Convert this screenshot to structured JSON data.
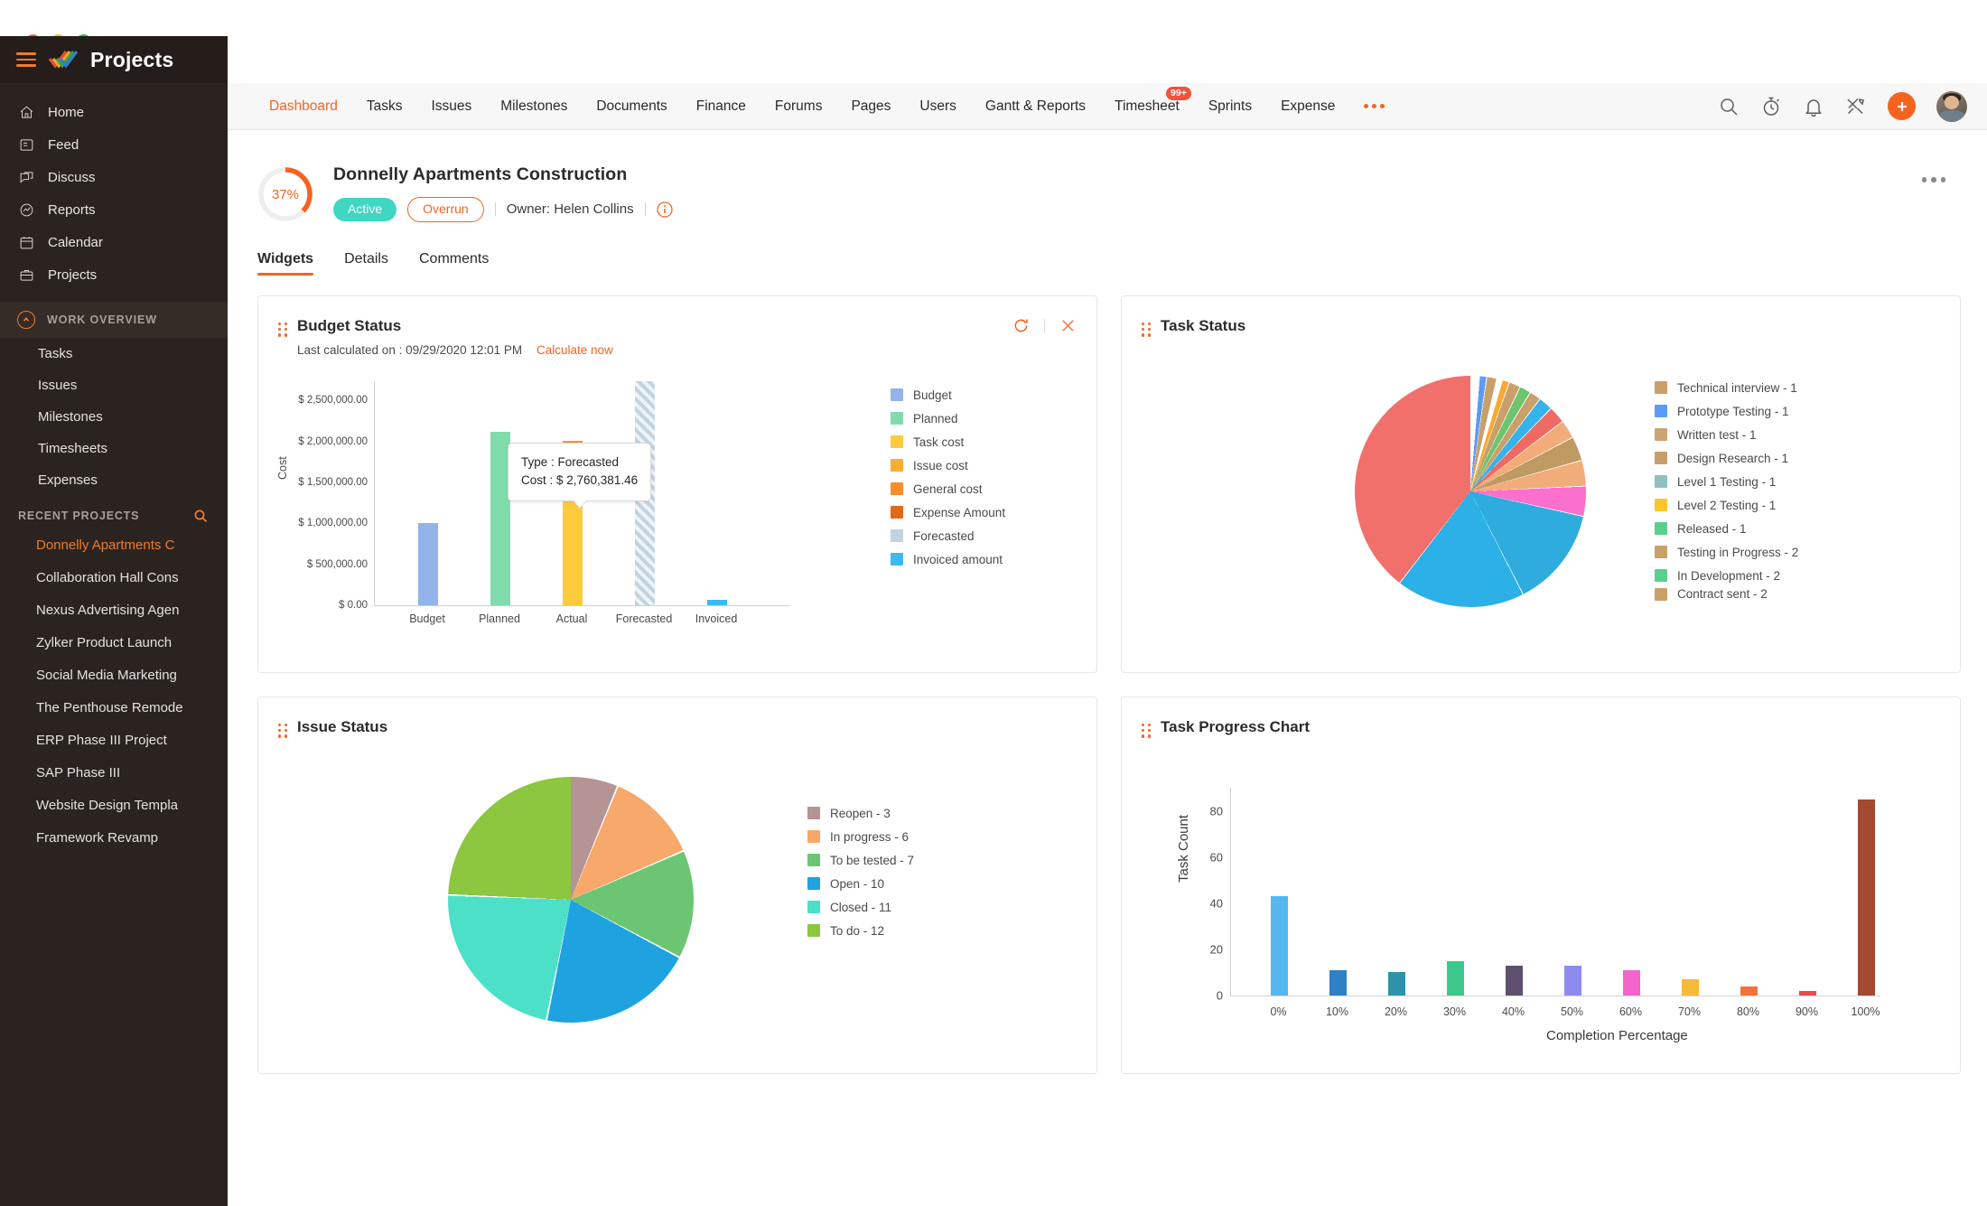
{
  "window": {
    "traffic_lights": [
      "close",
      "minimize",
      "zoom"
    ]
  },
  "brand": {
    "name": "Projects",
    "menu_icon": "hamburger-icon",
    "logo_icon": "zoho-projects-logo"
  },
  "sidebar": {
    "main_items": [
      {
        "label": "Home",
        "icon": "home-icon"
      },
      {
        "label": "Feed",
        "icon": "feed-icon"
      },
      {
        "label": "Discuss",
        "icon": "discuss-icon"
      },
      {
        "label": "Reports",
        "icon": "reports-icon"
      },
      {
        "label": "Calendar",
        "icon": "calendar-icon"
      },
      {
        "label": "Projects",
        "icon": "briefcase-icon"
      }
    ],
    "work_overview": {
      "label": "WORK OVERVIEW",
      "collapse_icon": "chevron-up-circle-icon",
      "items": [
        {
          "label": "Tasks"
        },
        {
          "label": "Issues"
        },
        {
          "label": "Milestones"
        },
        {
          "label": "Timesheets"
        },
        {
          "label": "Expenses"
        }
      ]
    },
    "recent_projects": {
      "label": "RECENT PROJECTS",
      "search_icon": "search-icon",
      "items": [
        {
          "label": "Donnelly Apartments C",
          "active": true
        },
        {
          "label": "Collaboration Hall Cons",
          "active": false
        },
        {
          "label": "Nexus Advertising Agen",
          "active": false
        },
        {
          "label": "Zylker Product Launch",
          "active": false
        },
        {
          "label": "Social Media Marketing",
          "active": false
        },
        {
          "label": "The Penthouse Remode",
          "active": false
        },
        {
          "label": "ERP Phase III Project",
          "active": false
        },
        {
          "label": "SAP Phase III",
          "active": false
        },
        {
          "label": "Website Design Templa",
          "active": false
        },
        {
          "label": "Framework Revamp",
          "active": false
        }
      ]
    }
  },
  "topnav": {
    "items": [
      {
        "label": "Dashboard",
        "active": true
      },
      {
        "label": "Tasks",
        "active": false
      },
      {
        "label": "Issues",
        "active": false
      },
      {
        "label": "Milestones",
        "active": false
      },
      {
        "label": "Documents",
        "active": false
      },
      {
        "label": "Finance",
        "active": false
      },
      {
        "label": "Forums",
        "active": false
      },
      {
        "label": "Pages",
        "active": false
      },
      {
        "label": "Users",
        "active": false
      },
      {
        "label": "Gantt & Reports",
        "active": false
      },
      {
        "label": "Timesheet",
        "active": false,
        "badge": "99+"
      },
      {
        "label": "Sprints",
        "active": false
      },
      {
        "label": "Expense",
        "active": false
      }
    ],
    "overflow_icon": "more-horizontal-icon",
    "right_icons": [
      {
        "name": "search-icon"
      },
      {
        "name": "timer-icon"
      },
      {
        "name": "bell-icon"
      },
      {
        "name": "tools-icon"
      }
    ],
    "add_button_label": "+",
    "avatar": "user-avatar"
  },
  "project": {
    "progress_percent": "37%",
    "progress_value": 37,
    "title": "Donnelly Apartments Construction",
    "status_badge": "Active",
    "overrun_badge": "Overrun",
    "owner": "Owner: Helen Collins",
    "info_icon": "info-icon",
    "more_icon": "more-options-icon"
  },
  "tabs": [
    {
      "label": "Widgets",
      "active": true
    },
    {
      "label": "Details",
      "active": false
    },
    {
      "label": "Comments",
      "active": false
    }
  ],
  "widgets": {
    "budget": {
      "title": "Budget Status",
      "subtitle": "Last calculated on : 09/29/2020 12:01 PM",
      "calculate_link": "Calculate now",
      "refresh_icon": "refresh-icon",
      "close_icon": "close-icon",
      "tooltip": {
        "line1": "Type : Forecasted",
        "line2": "Cost : $ 2,760,381.46"
      }
    },
    "task_status": {
      "title": "Task Status",
      "drag_icon": "drag-handle-icon"
    },
    "issue_status": {
      "title": "Issue Status",
      "drag_icon": "drag-handle-icon"
    },
    "task_progress": {
      "title": "Task Progress Chart",
      "drag_icon": "drag-handle-icon"
    }
  },
  "chart_data": [
    {
      "type": "bar",
      "title": "Budget Status",
      "xlabel": "",
      "ylabel": "Cost",
      "categories": [
        "Budget",
        "Planned",
        "Actual",
        "Forecasted",
        "Invoiced"
      ],
      "values": [
        1010000,
        2125000,
        2020000,
        2760381.46,
        60000
      ],
      "ylim": [
        0,
        2750000
      ],
      "yticks": [
        "$ 0.00",
        "$ 500,000.00",
        "$ 1,000,000.00",
        "$ 1,500,000.00",
        "$ 2,000,000.00",
        "$ 2,500,000.00"
      ],
      "ytick_values": [
        0,
        500000,
        1000000,
        1500000,
        2000000,
        2500000
      ],
      "grid": false,
      "legend_position": "right",
      "series": [
        {
          "name": "Budget",
          "color": "#93b3ea",
          "values": [
            1010000,
            null,
            null,
            null,
            null
          ]
        },
        {
          "name": "Planned",
          "color": "#80dcab",
          "values": [
            null,
            2125000,
            null,
            null,
            null
          ]
        },
        {
          "name": "Task cost",
          "color": "#fdcb3c",
          "values": [
            null,
            null,
            1740000,
            null,
            null
          ]
        },
        {
          "name": "Issue cost",
          "color": "#f9ad31",
          "values": [
            null,
            null,
            0,
            null,
            null
          ]
        },
        {
          "name": "General cost",
          "color": "#f98e28",
          "values": [
            null,
            null,
            280000,
            null,
            null
          ]
        },
        {
          "name": "Expense Amount",
          "color": "#e06a18",
          "values": [
            null,
            null,
            0,
            null,
            null
          ]
        },
        {
          "name": "Forecasted",
          "color": "#c2d3e0",
          "values": [
            null,
            null,
            null,
            2760381.46,
            null
          ]
        },
        {
          "name": "Invoiced amount",
          "color": "#3bb9f0",
          "values": [
            null,
            null,
            null,
            null,
            60000
          ]
        }
      ]
    },
    {
      "type": "pie",
      "title": "Task Status",
      "legend_position": "right",
      "slices": [
        {
          "label": "Technical interview - 1",
          "value": 1,
          "color": "#c9a06a"
        },
        {
          "label": "Prototype Testing - 1",
          "value": 1,
          "color": "#5b9bf5"
        },
        {
          "label": "Written test - 1",
          "value": 1,
          "color": "#cba475"
        },
        {
          "label": "Design Research - 1",
          "value": 1,
          "color": "#c79f6c"
        },
        {
          "label": "Level 1 Testing - 1",
          "value": 1,
          "color": "#8fc0c0"
        },
        {
          "label": "Level 2 Testing - 1",
          "value": 1,
          "color": "#fcc52b"
        },
        {
          "label": "Released - 1",
          "value": 1,
          "color": "#5ccf8e"
        },
        {
          "label": "Testing in Progress - 2",
          "value": 2,
          "color": "#c9a06a"
        },
        {
          "label": "In Development - 2",
          "value": 2,
          "color": "#5ccf8e"
        },
        {
          "label": "Contract sent - 2",
          "value": 2,
          "color": "#c9a06a"
        }
      ],
      "visible_slices": [
        {
          "color": "#ffffff",
          "value": 1.2
        },
        {
          "color": "#5b9bf5",
          "value": 1.0
        },
        {
          "color": "#c9a06a",
          "value": 1.4
        },
        {
          "color": "#ffffff",
          "value": 0.8
        },
        {
          "color": "#f9a92f",
          "value": 1.0
        },
        {
          "color": "#c9a06a",
          "value": 1.6
        },
        {
          "color": "#6fc46f",
          "value": 1.6
        },
        {
          "color": "#c9a06a",
          "value": 1.6
        },
        {
          "color": "#35b3ea",
          "value": 2.0
        },
        {
          "color": "#ef6a63",
          "value": 2.4
        },
        {
          "color": "#f2ac79",
          "value": 2.6
        },
        {
          "color": "#c09a63",
          "value": 3.4
        },
        {
          "color": "#f2ac79",
          "value": 3.6
        },
        {
          "color": "#fb6fce",
          "value": 4.2
        },
        {
          "color": "#2eacde",
          "value": 14.0
        },
        {
          "color": "#2bb0e8",
          "value": 18.0
        },
        {
          "color": "#f1706b",
          "value": 39.6
        }
      ]
    },
    {
      "type": "pie",
      "title": "Issue Status",
      "legend_position": "right",
      "slices": [
        {
          "label": "Reopen - 3",
          "value": 3,
          "color": "#b49494"
        },
        {
          "label": "In progress - 6",
          "value": 6,
          "color": "#f7a86a"
        },
        {
          "label": "To be tested - 7",
          "value": 7,
          "color": "#6cc573"
        },
        {
          "label": "Open - 10",
          "value": 10,
          "color": "#1fa3e0"
        },
        {
          "label": "Closed - 11",
          "value": 11,
          "color": "#4ce0c9"
        },
        {
          "label": "To do - 12",
          "value": 12,
          "color": "#8dc63f"
        }
      ]
    },
    {
      "type": "bar",
      "title": "Task Progress Chart",
      "xlabel": "Completion Percentage",
      "ylabel": "Task Count",
      "categories": [
        "0%",
        "10%",
        "20%",
        "30%",
        "40%",
        "50%",
        "60%",
        "70%",
        "80%",
        "90%",
        "100%"
      ],
      "values": [
        43,
        11,
        10,
        15,
        13,
        13,
        11,
        7,
        4,
        2,
        85
      ],
      "colors": [
        "#54b7f0",
        "#2f80c4",
        "#2f92ab",
        "#3dc98e",
        "#5e4f6e",
        "#8c8cf0",
        "#f563cd",
        "#f9b93a",
        "#f5713a",
        "#e74c4c",
        "#a24a32"
      ],
      "ylim": [
        0,
        90
      ],
      "yticks": [
        "0",
        "20",
        "40",
        "60",
        "80"
      ],
      "ytick_values": [
        0,
        20,
        40,
        60,
        80
      ],
      "grid": false,
      "legend_position": "none"
    }
  ]
}
